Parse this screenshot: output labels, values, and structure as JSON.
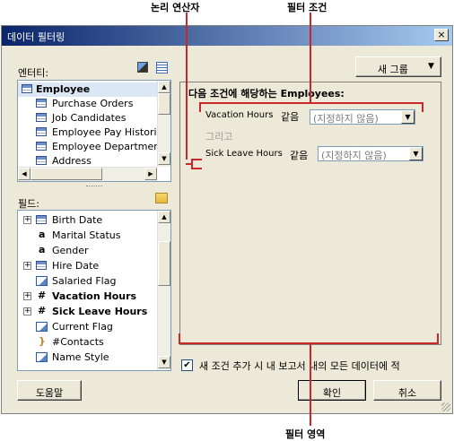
{
  "callouts": {
    "logical_operator": "논리 연산자",
    "filter_condition": "필터 조건",
    "filter_area": "필터 영역"
  },
  "dialog": {
    "title": "데이터 필터링",
    "close_glyph": "×"
  },
  "entities": {
    "label": "엔터티:",
    "items": [
      {
        "label": "Employee",
        "bold": true
      },
      {
        "label": "Purchase Orders"
      },
      {
        "label": "Job Candidates"
      },
      {
        "label": "Employee Pay Histories"
      },
      {
        "label": "Employee Department H"
      },
      {
        "label": "Address"
      }
    ]
  },
  "fields": {
    "label": "필드:",
    "items": [
      {
        "label": "Birth Date",
        "icon": "table",
        "expander": "+"
      },
      {
        "label": "Marital Status",
        "icon": "a"
      },
      {
        "label": "Gender",
        "icon": "a"
      },
      {
        "label": "Hire Date",
        "icon": "table",
        "expander": "+"
      },
      {
        "label": "Salaried Flag",
        "icon": "flag"
      },
      {
        "label": "Vacation Hours",
        "icon": "#",
        "expander": "+",
        "bold": true
      },
      {
        "label": "Sick Leave Hours",
        "icon": "#",
        "expander": "+",
        "bold": true
      },
      {
        "label": "Current Flag",
        "icon": "flag"
      },
      {
        "label": "#Contacts",
        "icon": "brace"
      },
      {
        "label": "Name Style",
        "icon": "flag"
      }
    ]
  },
  "new_group_button": "새 그룹",
  "filter": {
    "header_prefix": "다음 조건에 해당하는",
    "header_entity": "Employees:",
    "conditions": [
      {
        "field": "Vacation Hours",
        "operator": "같음",
        "value": "(지정하지 않음)"
      },
      {
        "field": "Sick Leave Hours",
        "operator": "같음",
        "value": "(지정하지 않음)"
      }
    ],
    "logical_operator": "그리고"
  },
  "checkbox": {
    "label": "새 조건 추가 시 내 보고서 내의 모든 데이터에 적",
    "checked": true,
    "glyph": "✔"
  },
  "buttons": {
    "help": "도움말",
    "ok": "확인",
    "cancel": "취소"
  },
  "colors": {
    "callout_red": "#c8282a",
    "title_gradient_start": "#0a246a",
    "dialog_bg": "#ece9d8"
  }
}
